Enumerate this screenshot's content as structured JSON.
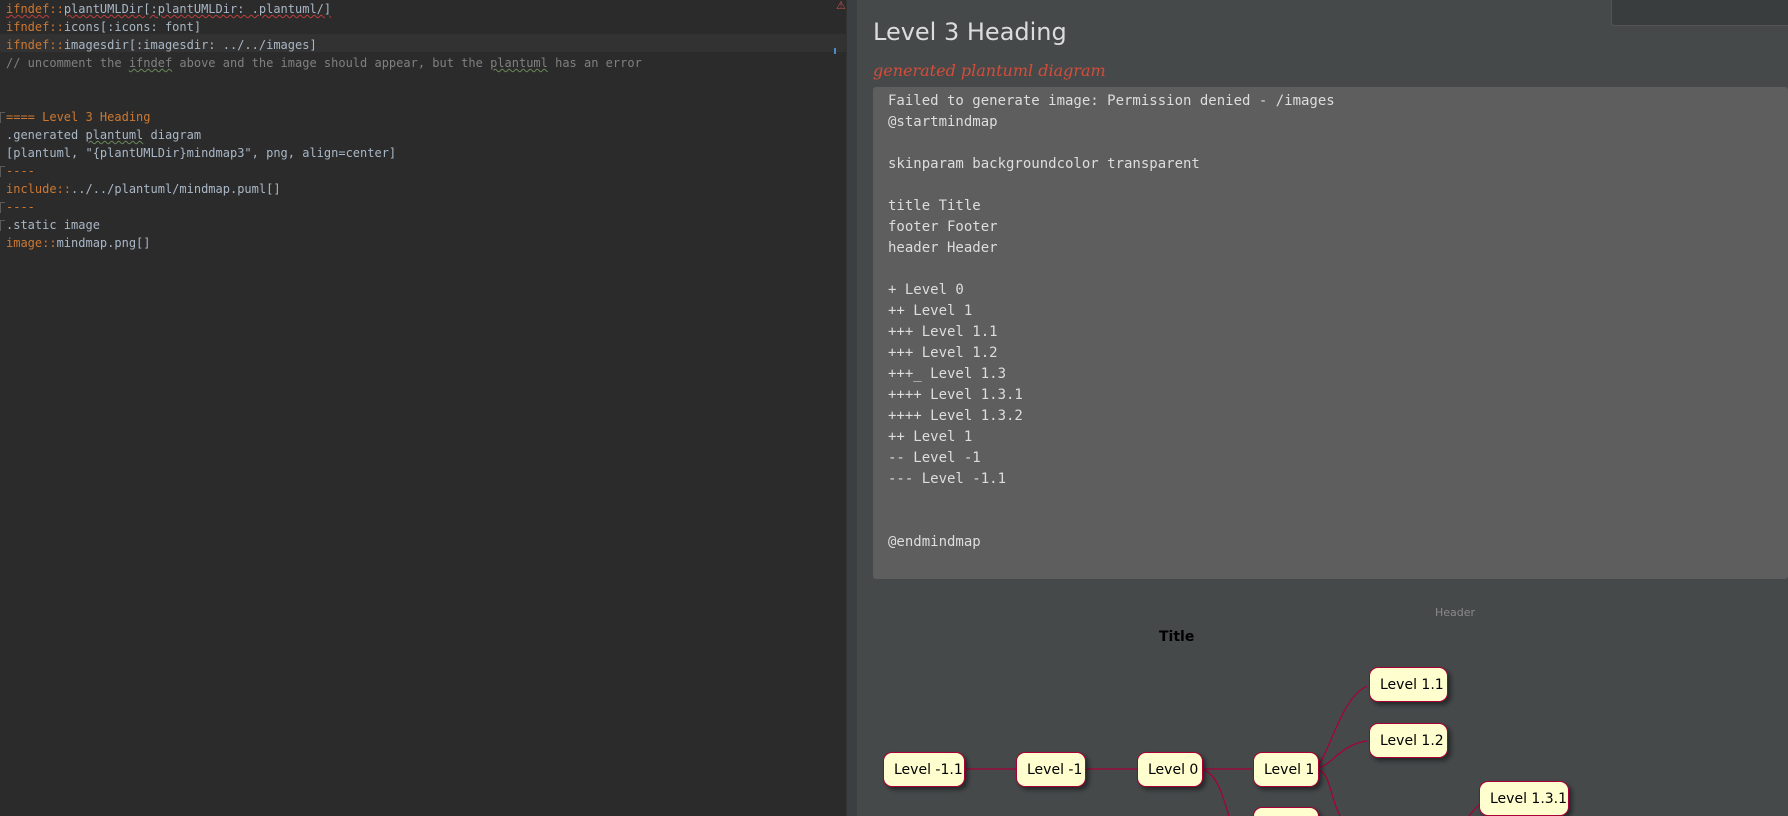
{
  "editor": {
    "lines": [
      {
        "parts": [
          {
            "t": "ifndef",
            "c": "kw squig"
          },
          {
            "t": "::",
            "c": "kw"
          },
          {
            "t": "plantUMLDir[:plantUMLDir: .plantuml/]",
            "c": "squig"
          }
        ]
      },
      {
        "parts": [
          {
            "t": "ifndef",
            "c": "kw"
          },
          {
            "t": "::",
            "c": "kw"
          },
          {
            "t": "icons[:icons: font]",
            "c": ""
          }
        ]
      },
      {
        "parts": [
          {
            "t": "ifndef",
            "c": "kw"
          },
          {
            "t": "::",
            "c": "kw"
          },
          {
            "t": "imagesdir[:imagesdir: ../../images]",
            "c": ""
          }
        ]
      },
      {
        "parts": [
          {
            "t": "// uncomment the ",
            "c": "cm"
          },
          {
            "t": "ifndef",
            "c": "cm squig-g"
          },
          {
            "t": " above and the image should appear, but the ",
            "c": "cm"
          },
          {
            "t": "plantuml",
            "c": "cm squig-g"
          },
          {
            "t": " has an error",
            "c": "cm"
          }
        ]
      },
      {
        "parts": []
      },
      {
        "parts": []
      },
      {
        "parts": [
          {
            "t": "==== Level 3 Heading",
            "c": "kw"
          }
        ]
      },
      {
        "parts": [
          {
            "t": ".generated ",
            "c": ""
          },
          {
            "t": "plantuml",
            "c": "squig-g"
          },
          {
            "t": " diagram",
            "c": ""
          }
        ]
      },
      {
        "parts": [
          {
            "t": "[plantuml, ",
            "c": ""
          },
          {
            "t": "\"{plantUMLDir}mindmap3\"",
            "c": ""
          },
          {
            "t": ", png, align=center]",
            "c": ""
          }
        ]
      },
      {
        "parts": [
          {
            "t": "----",
            "c": "kw"
          }
        ]
      },
      {
        "parts": [
          {
            "t": "include",
            "c": "kw"
          },
          {
            "t": "::",
            "c": "kw"
          },
          {
            "t": "../../plantuml/mindmap.puml[]",
            "c": ""
          }
        ]
      },
      {
        "parts": [
          {
            "t": "----",
            "c": "kw"
          }
        ]
      },
      {
        "parts": [
          {
            "t": ".static image",
            "c": ""
          }
        ]
      },
      {
        "parts": [
          {
            "t": "image",
            "c": "kw"
          },
          {
            "t": "::",
            "c": "kw"
          },
          {
            "t": "mindmap.png[]",
            "c": ""
          }
        ]
      }
    ],
    "error_icon": "warning-icon"
  },
  "preview": {
    "heading": "Level 3 Heading",
    "caption": "generated plantuml diagram",
    "code_lines": [
      "Failed to generate image: Permission denied - /images",
      "@startmindmap",
      "",
      "skinparam backgroundcolor transparent",
      "",
      "title Title",
      "footer Footer",
      "header Header",
      "",
      "+ Level 0",
      "++ Level 1",
      "+++ Level 1.1",
      "+++ Level 1.2",
      "+++_ Level 1.3",
      "++++ Level 1.3.1",
      "++++ Level 1.3.2",
      "++ Level 1",
      "-- Level -1",
      "--- Level -1.1",
      "",
      "",
      "@endmindmap"
    ],
    "diagram": {
      "header": "Header",
      "title": "Title",
      "nodes": {
        "lm11": "Level -1.1",
        "lm1": "Level -1",
        "l0": "Level 0",
        "l1": "Level 1",
        "l11": "Level 1.1",
        "l12": "Level 1.2",
        "l131": "Level 1.3.1"
      }
    }
  }
}
